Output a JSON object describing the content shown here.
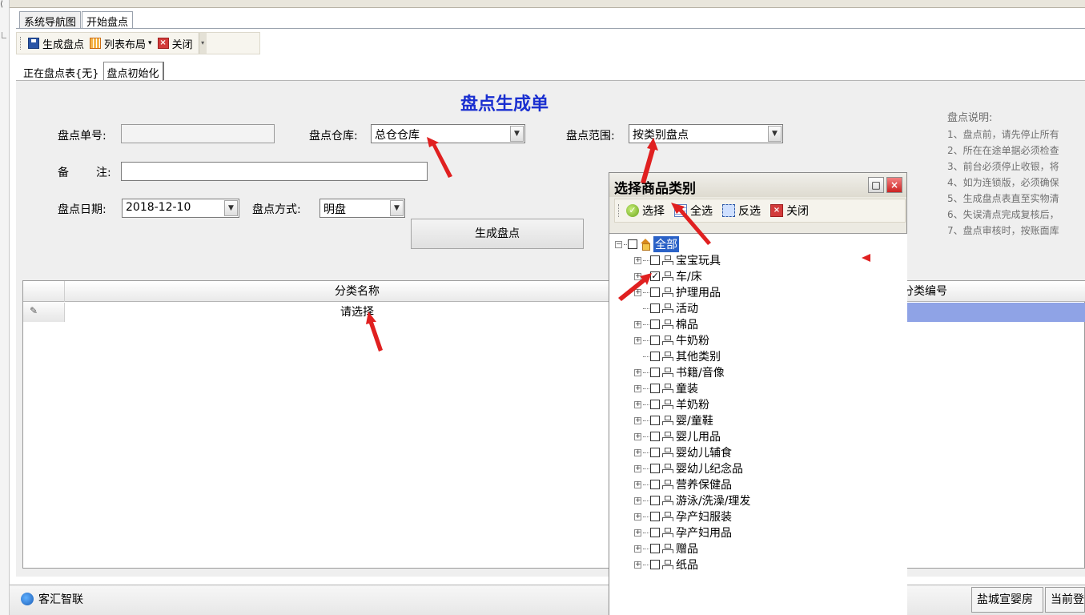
{
  "main_tabs": [
    {
      "label": "系统导航图",
      "active": false
    },
    {
      "label": "开始盘点",
      "active": true
    }
  ],
  "toolbar": {
    "generate_label": "生成盘点",
    "layout_label": "列表布局",
    "close_label": "关闭"
  },
  "inner_tabs": [
    {
      "label": "正在盘点表{无}",
      "active": false
    },
    {
      "label": "盘点初始化",
      "active": true
    }
  ],
  "form": {
    "title": "盘点生成单",
    "order_no_label": "盘点单号:",
    "order_no_value": "",
    "warehouse_label": "盘点仓库:",
    "warehouse_value": "总仓仓库",
    "scope_label": "盘点范围:",
    "scope_value": "按类别盘点",
    "remark_label_1": "备",
    "remark_label_2": "注:",
    "remark_value": "",
    "date_label": "盘点日期:",
    "date_value": "2018-12-10",
    "method_label": "盘点方式:",
    "method_value": "明盘",
    "generate_button": "生成盘点"
  },
  "notes": {
    "title": "盘点说明:",
    "lines": [
      "1、盘点前，请先停止所有",
      "2、所在在途单据必须检查",
      "3、前台必须停止收银，将",
      "4、如为连锁版，必须确保",
      "5、生成盘点表直至实物清",
      "6、失误清点完成复核后，",
      "7、盘点审核时，按账面库"
    ]
  },
  "grid": {
    "col_category_name": "分类名称",
    "col_category_code": "分类编号",
    "row_indicator": "✎",
    "row_value": "请选择"
  },
  "status": {
    "app_name": "客汇智联",
    "store": "盐城宣婴房",
    "current_login": "当前登"
  },
  "dialog": {
    "title": "选择商品类别",
    "select_label": "选择",
    "select_all_label": "全选",
    "invert_label": "反选",
    "close_label": "关闭",
    "root_label": "全部",
    "categories": [
      {
        "label": "宝宝玩具",
        "expandable": true,
        "checked": false
      },
      {
        "label": "车/床",
        "expandable": true,
        "checked": true
      },
      {
        "label": "护理用品",
        "expandable": true,
        "checked": false
      },
      {
        "label": "活动",
        "expandable": false,
        "checked": false
      },
      {
        "label": "棉品",
        "expandable": true,
        "checked": false
      },
      {
        "label": "牛奶粉",
        "expandable": true,
        "checked": false
      },
      {
        "label": "其他类别",
        "expandable": false,
        "checked": false
      },
      {
        "label": "书籍/音像",
        "expandable": true,
        "checked": false
      },
      {
        "label": "童装",
        "expandable": true,
        "checked": false
      },
      {
        "label": "羊奶粉",
        "expandable": true,
        "checked": false
      },
      {
        "label": "婴/童鞋",
        "expandable": true,
        "checked": false
      },
      {
        "label": "婴儿用品",
        "expandable": true,
        "checked": false
      },
      {
        "label": "婴幼儿辅食",
        "expandable": true,
        "checked": false
      },
      {
        "label": "婴幼儿纪念品",
        "expandable": true,
        "checked": false
      },
      {
        "label": "营养保健品",
        "expandable": true,
        "checked": false
      },
      {
        "label": "游泳/洗澡/理发",
        "expandable": true,
        "checked": false
      },
      {
        "label": "孕产妇服装",
        "expandable": true,
        "checked": false
      },
      {
        "label": "孕产妇用品",
        "expandable": true,
        "checked": false
      },
      {
        "label": "赠品",
        "expandable": true,
        "checked": false
      },
      {
        "label": "纸品",
        "expandable": true,
        "checked": false
      }
    ]
  },
  "colors": {
    "title_blue": "#1a2fd0",
    "selection_blue": "#8fa3e6",
    "arrow_red": "#e02020",
    "tree_selected": "#2b62c7"
  }
}
